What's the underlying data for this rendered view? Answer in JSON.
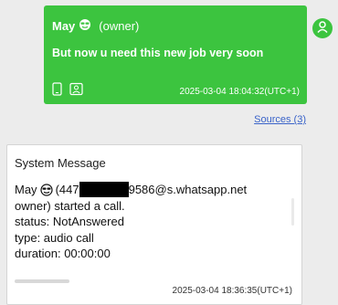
{
  "message_out": {
    "sender_name": "May",
    "sender_role": "(owner)",
    "text": "But now u need this new job very soon",
    "timestamp": "2025-03-04 18:04:32(UTC+1)",
    "icons": [
      "phone-icon",
      "contact-card-icon"
    ],
    "emoji_icon": "cool-face-emoji-icon"
  },
  "avatar": {
    "icon": "person-icon"
  },
  "sources": {
    "label": "Sources (3)"
  },
  "system_message": {
    "title": "System Message",
    "line1_name": "May",
    "line1_prefix": "(447",
    "line1_suffix": "9586@s.whatsapp.net",
    "line2": "owner) started a call.",
    "line3": "status: NotAnswered",
    "line4": "type: audio call",
    "line5": "duration: 00:00:00",
    "timestamp": "2025-03-04 18:36:35(UTC+1)"
  },
  "colors": {
    "bubble_green": "#3cc43f",
    "link_blue": "#3a63c9"
  }
}
